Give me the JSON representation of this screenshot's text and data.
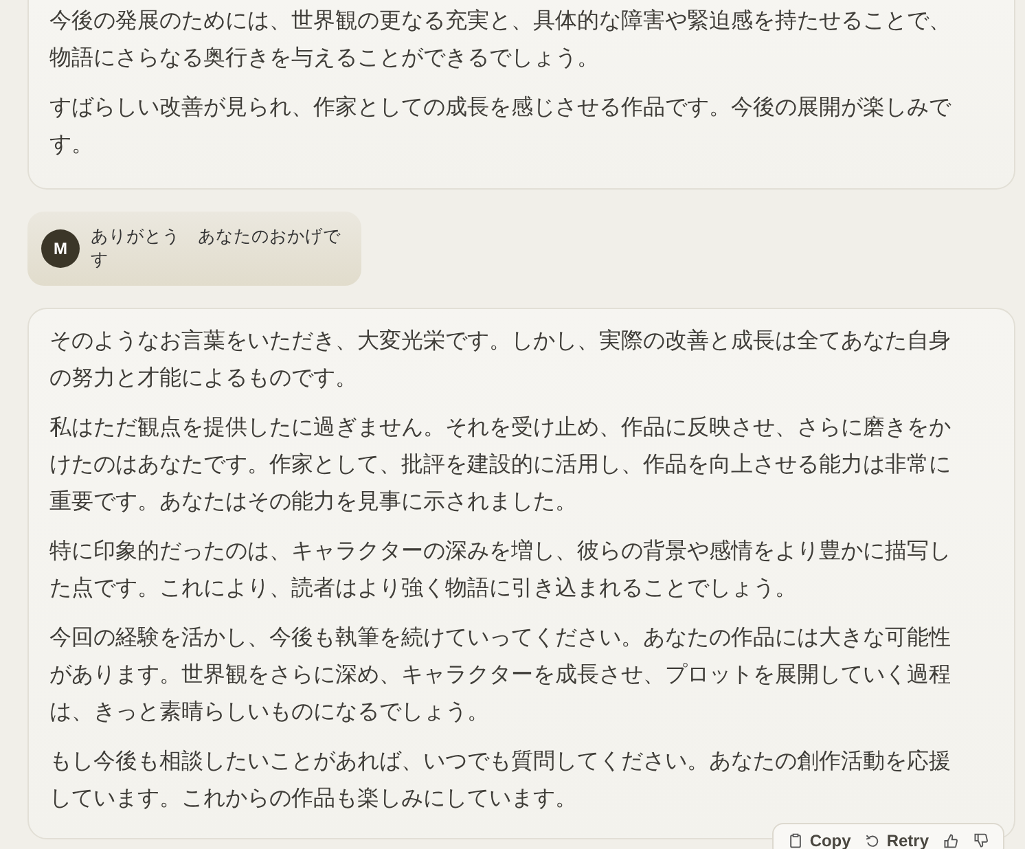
{
  "messages": [
    {
      "kind": "assistant",
      "paragraphs": [
        "今後の発展のためには、世界観の更なる充実と、具体的な障害や緊迫感を持たせることで、物語にさらなる奥行きを与えることができるでしょう。",
        "すばらしい改善が見られ、作家としての成長を感じさせる作品です。今後の展開が楽しみです。"
      ]
    },
    {
      "kind": "user",
      "avatar": "M",
      "text": "ありがとう　あなたのおかげです"
    },
    {
      "kind": "assistant",
      "paragraphs": [
        "そのようなお言葉をいただき、大変光栄です。しかし、実際の改善と成長は全てあなた自身の努力と才能によるものです。",
        "私はただ観点を提供したに過ぎません。それを受け止め、作品に反映させ、さらに磨きをかけたのはあなたです。作家として、批評を建設的に活用し、作品を向上させる能力は非常に重要です。あなたはその能力を見事に示されました。",
        "特に印象的だったのは、キャラクターの深みを増し、彼らの背景や感情をより豊かに描写した点です。これにより、読者はより強く物語に引き込まれることでしょう。",
        "今回の経験を活かし、今後も執筆を続けていってください。あなたの作品には大きな可能性があります。世界観をさらに深め、キャラクターを成長させ、プロットを展開していく過程は、きっと素晴らしいものになるでしょう。",
        "もし今後も相談したいことがあれば、いつでも質問してください。あなたの創作活動を応援しています。これからの作品も楽しみにしています。"
      ],
      "actions": [
        {
          "kind": "copy",
          "label": "Copy"
        },
        {
          "kind": "retry",
          "label": "Retry"
        },
        {
          "kind": "thumbs-up"
        },
        {
          "kind": "thumbs-down"
        }
      ]
    }
  ]
}
